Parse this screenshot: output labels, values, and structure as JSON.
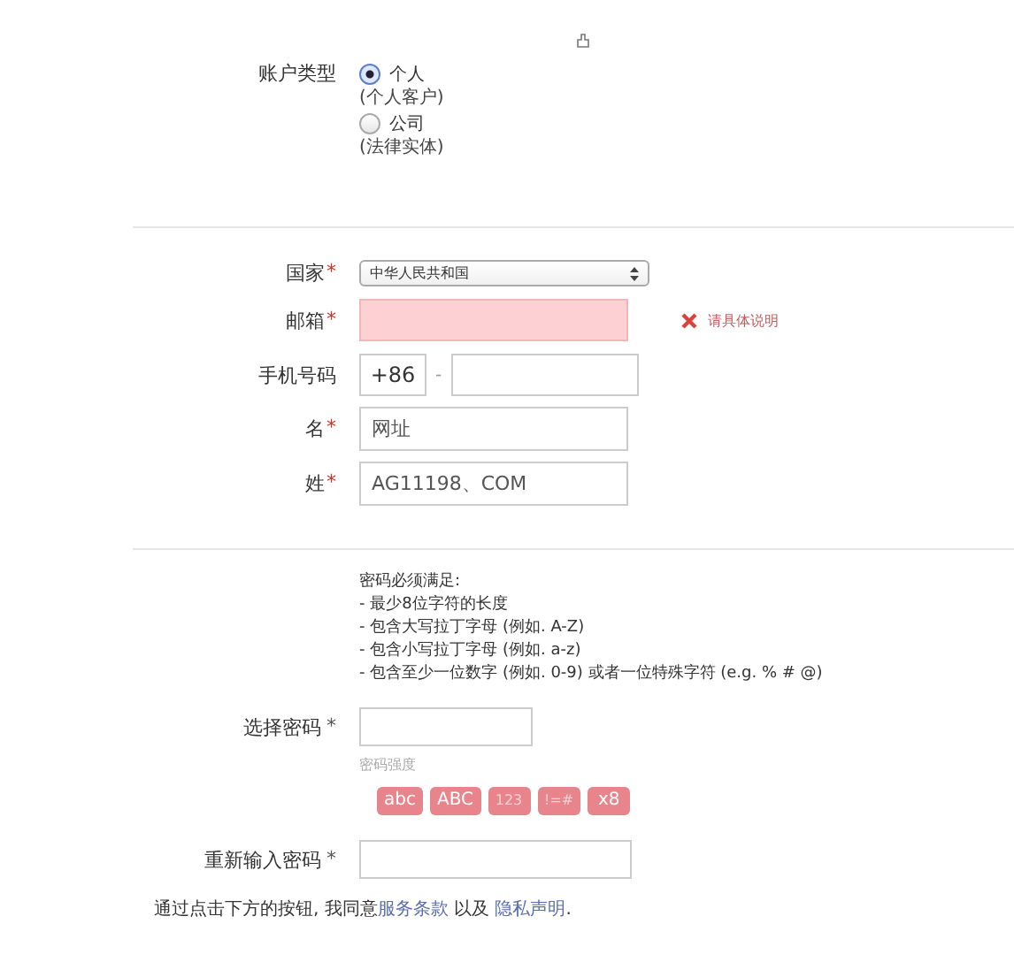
{
  "account_type": {
    "label": "账户类型",
    "options": [
      {
        "label": "个人",
        "note": "(个人客户)",
        "selected": true
      },
      {
        "label": "公司",
        "note": "(法律实体)",
        "selected": false
      }
    ]
  },
  "fields": [
    {
      "kind": "select",
      "label": "国家",
      "required_mark": "*",
      "value": "中华人民共和国"
    },
    {
      "kind": "text",
      "label": "邮箱",
      "required_mark": "*",
      "invalid": true,
      "error": "请具体说明"
    },
    {
      "kind": "phone",
      "label": "手机号码",
      "prefix": "+86",
      "separator": "-"
    },
    {
      "kind": "text",
      "label": "名",
      "required_mark": "*",
      "value": "网址",
      "invalid": false
    },
    {
      "kind": "text",
      "label": "姓",
      "required_mark": "*",
      "value": "AG11198、COM",
      "invalid": false
    }
  ],
  "password_rules": {
    "title": "密码必须满足:",
    "items": [
      "- 最少8位字符的长度",
      "- 包含大写拉丁字母 (例如. A-Z)",
      "- 包含小写拉丁字母 (例如. a-z)",
      "- 包含至少一位数字 (例如. 0-9) 或者一位特殊字符 (e.g. % # @)"
    ]
  },
  "password": {
    "label": "选择密码",
    "required_mark": "*"
  },
  "strength": {
    "label": "密码强度",
    "badges": [
      {
        "text": "abc",
        "met": true
      },
      {
        "text": "ABC",
        "met": true
      },
      {
        "text": "123",
        "met": false
      },
      {
        "text": "!=#",
        "met": false
      },
      {
        "text": "x8",
        "met": true
      }
    ]
  },
  "confirm": {
    "label": "重新输入密码",
    "required_mark": "*"
  },
  "terms": {
    "text": "通过点击下方的按钮, 我同意",
    "link1": "服务条款",
    "middle": " 以及 ",
    "link2": "隐私声明",
    "end": "."
  }
}
